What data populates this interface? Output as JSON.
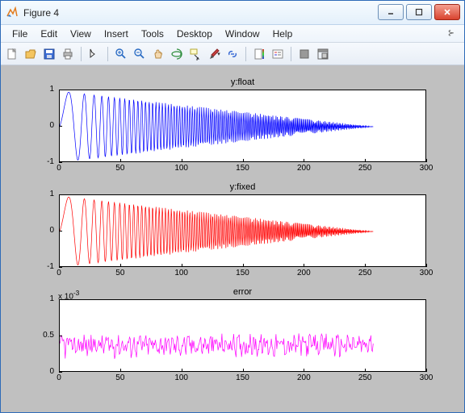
{
  "window": {
    "title": "Figure 4"
  },
  "menu": {
    "file": "File",
    "edit": "Edit",
    "view": "View",
    "insert": "Insert",
    "tools": "Tools",
    "desktop": "Desktop",
    "window": "Window",
    "help": "Help"
  },
  "toolbar": {
    "new": "new-figure",
    "open": "open",
    "save": "save",
    "print": "print",
    "edit": "edit-plot",
    "zoomin": "zoom-in",
    "zoomout": "zoom-out",
    "pan": "pan",
    "rotate": "rotate-3d",
    "datacursor": "data-cursor",
    "brush": "brush",
    "link": "link",
    "colorbar": "insert-colorbar",
    "legend": "insert-legend",
    "hide": "hide-tools",
    "dock": "dock-figure"
  },
  "charts": [
    {
      "title": "y:float",
      "color": "#0000FF",
      "xlim": [
        0,
        300
      ],
      "ylim": [
        -1,
        1
      ],
      "xticks": [
        0,
        50,
        100,
        150,
        200,
        250,
        300
      ],
      "yticks": [
        -1,
        0,
        1
      ],
      "series": "chirp_decay"
    },
    {
      "title": "y:fixed",
      "color": "#FF0000",
      "xlim": [
        0,
        300
      ],
      "ylim": [
        -1,
        1
      ],
      "xticks": [
        0,
        50,
        100,
        150,
        200,
        250,
        300
      ],
      "yticks": [
        -1,
        0,
        1
      ],
      "series": "chirp_decay"
    },
    {
      "title": "error",
      "color": "#FF00FF",
      "xlim": [
        0,
        300
      ],
      "ylim": [
        0,
        1
      ],
      "yexp": "x 10",
      "xticks": [
        0,
        50,
        100,
        150,
        200,
        250,
        300
      ],
      "yticks": [
        0,
        0.5,
        1
      ],
      "series": "noise"
    }
  ],
  "chart_data": [
    {
      "type": "line",
      "title": "y:float",
      "x_range": [
        0,
        256
      ],
      "xlim": [
        0,
        300
      ],
      "ylim": [
        -1,
        1
      ],
      "description": "decaying chirp: y = env(x) * sin(phase(x)), env decays ~linear from 1 at x=0 to 0 at x=256, frequency increases with x",
      "series": [
        {
          "name": "y_float",
          "color": "#0000FF"
        }
      ]
    },
    {
      "type": "line",
      "title": "y:fixed",
      "x_range": [
        0,
        256
      ],
      "xlim": [
        0,
        300
      ],
      "ylim": [
        -1,
        1
      ],
      "description": "same decaying chirp as y:float recomputed in fixed-point",
      "series": [
        {
          "name": "y_fixed",
          "color": "#FF0000"
        }
      ]
    },
    {
      "type": "line",
      "title": "error",
      "x_range": [
        0,
        256
      ],
      "xlim": [
        0,
        300
      ],
      "ylim": [
        0,
        0.001
      ],
      "yexp": -3,
      "description": "abs(y_float - y_fixed), noisy, roughly 0.2e-3 to 0.5e-3 across the range",
      "series": [
        {
          "name": "error",
          "color": "#FF00FF"
        }
      ]
    }
  ]
}
